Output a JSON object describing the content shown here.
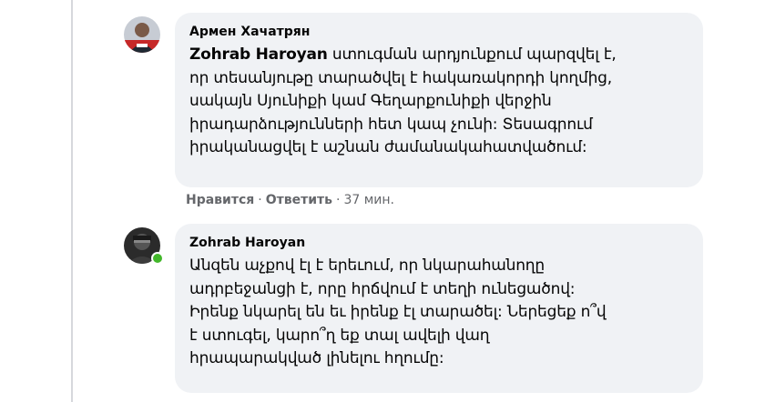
{
  "comments": [
    {
      "author": "Армен Хачатрян",
      "mention": "Zohrab Haroyan",
      "lines": [
        " ստուգման արդյունքում պարզվել է,",
        "որ տեսանյութը տարածվել է հակառակորդի կողմից,",
        "սակայն Սյունիքի կամ Գեղարքունիքի վերջին",
        "իրադարձությունների հետ կապ չունի: Տեսագրում",
        "իրականացվել է աշնան ժամանակահատվածում:"
      ],
      "actions": {
        "like": "Нравится",
        "reply": "Ответить",
        "separator": "·",
        "time": "37 мин."
      }
    },
    {
      "author": "Zohrab Haroyan",
      "lines": [
        "Անզեն աչքով էլ է երեւում, որ նկարահանողը",
        "ադրբեջանցի է, որը հրճվում է տեղի ունեցածով:",
        "Իրենք նկարել են եւ իրենք էլ տարածել: Ներեցեք ո՞վ",
        "է ստուգել, կարո՞ղ եք տալ ավելի վաղ",
        "հրապարակված լինելու հղումը:"
      ],
      "online": true
    }
  ],
  "colors": {
    "bubble": "#f0f2f5",
    "text": "#050505",
    "meta": "#65676b",
    "online": "#42b72a"
  },
  "icons": [
    "avatar-armen",
    "avatar-zohrab",
    "online-dot-icon"
  ]
}
